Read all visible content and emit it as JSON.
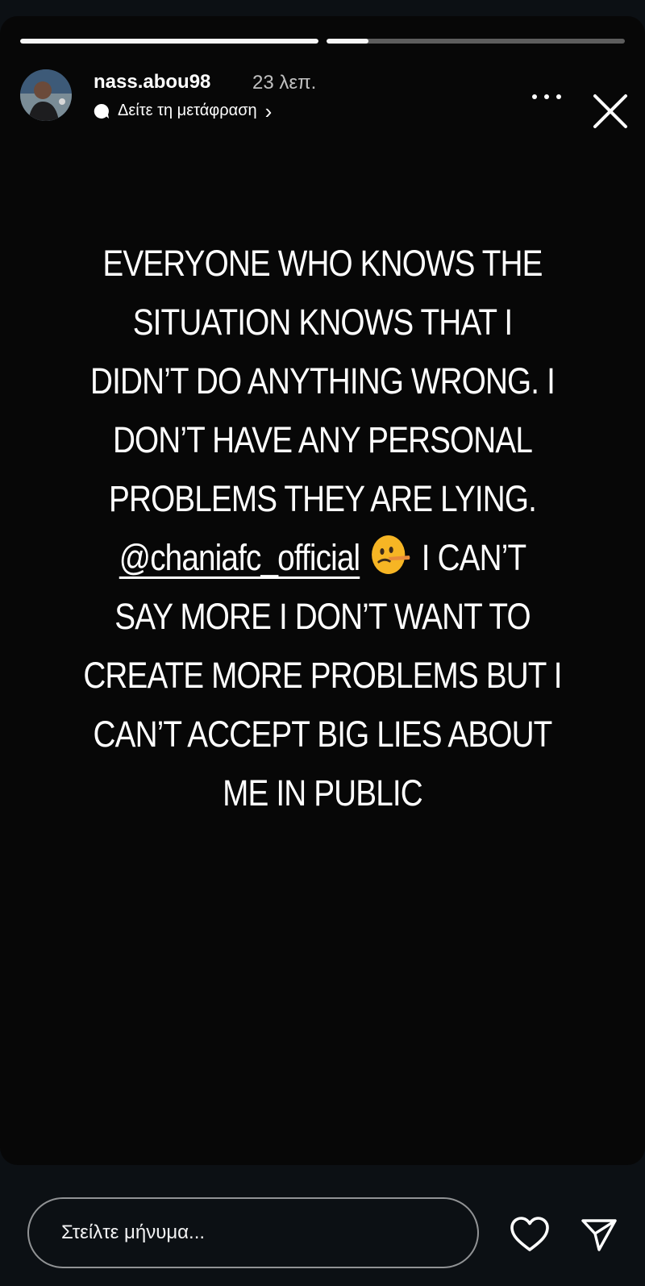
{
  "story": {
    "progress": [
      1.0,
      0.14
    ],
    "username": "nass.abou98",
    "timestamp": "23 λεπ.",
    "translate_label": "Δείτε τη μετάφραση",
    "translate_chevron": "›",
    "text": {
      "line1": "EVERYONE WHO KNOWS THE",
      "line2": "SITUATION KNOWS THAT I",
      "line3": "DIDN’T DO ANYTHING WRONG. I",
      "line4": "DON’T HAVE ANY PERSONAL",
      "line5": "PROBLEMS THEY ARE LYING.",
      "mention": "@chaniafc_official",
      "emoji": "lying-face-emoji",
      "line6_after": "I CAN’T",
      "line7": "SAY MORE I DON’T WANT TO",
      "line8": "CREATE MORE PROBLEMS BUT I",
      "line9": "CAN’T ACCEPT BIG LIES ABOUT",
      "line10": "ME IN PUBLIC"
    },
    "icons": [
      "more-icon",
      "close-icon"
    ]
  },
  "footer": {
    "message_placeholder": "Στείλτε μήνυμα...",
    "icons": [
      "heart-icon",
      "send-icon"
    ]
  },
  "colors": {
    "background": "#0c1014",
    "story_background": "#070707",
    "text": "#ffffff"
  }
}
